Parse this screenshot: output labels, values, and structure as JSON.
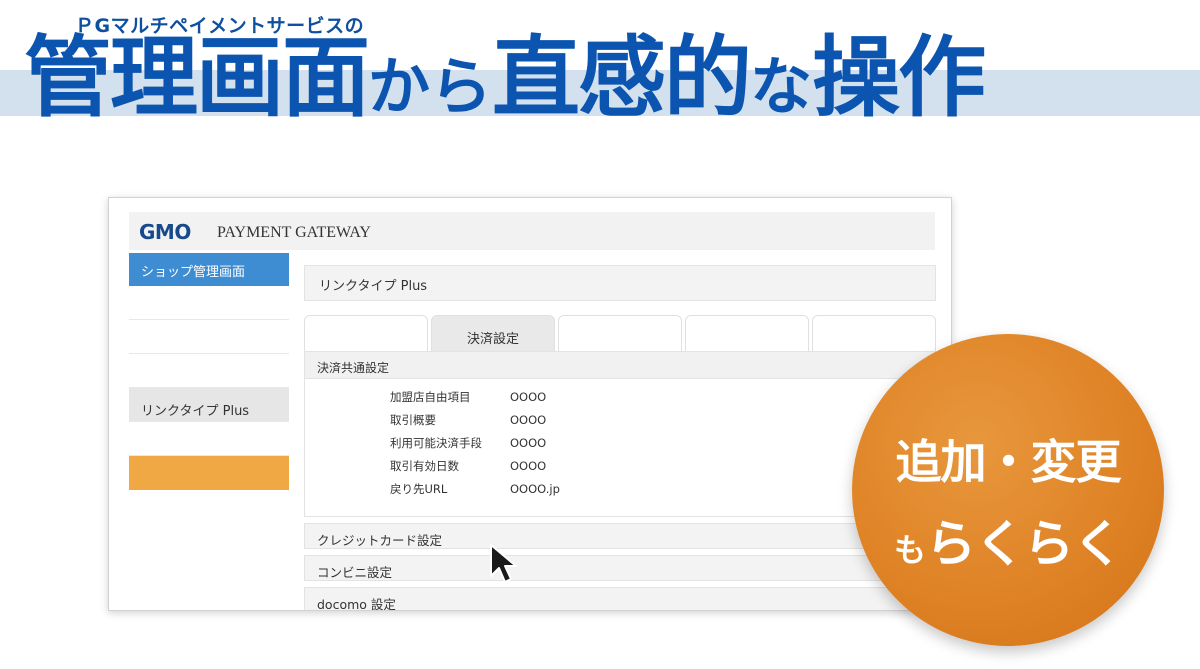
{
  "header": {
    "subtitle": "ＰGマルチペイメントサービスの",
    "headline_part1": "管理画面",
    "headline_part2": "から",
    "headline_part3": "直感的",
    "headline_part4": "な",
    "headline_part5": "操作"
  },
  "app": {
    "logo_mark": "GMO",
    "logo_text": "PAYMENT GATEWAY",
    "sidebar": {
      "items": [
        {
          "label": "ショップ管理画面"
        },
        {
          "label": ""
        },
        {
          "label": ""
        },
        {
          "label": ""
        },
        {
          "label": "リンクタイプ Plus"
        },
        {
          "label": ""
        },
        {
          "label": ""
        }
      ]
    },
    "page_title": "リンクタイプ Plus",
    "tabs": [
      {
        "label": ""
      },
      {
        "label": "決済設定"
      },
      {
        "label": ""
      },
      {
        "label": ""
      },
      {
        "label": ""
      }
    ],
    "panel_title": "決済共通設定",
    "fields": [
      {
        "key": "加盟店自由項目",
        "value": "OOOO"
      },
      {
        "key": "取引概要",
        "value": "OOOO"
      },
      {
        "key": "利用可能決済手段",
        "value": "OOOO"
      },
      {
        "key": "取引有効日数",
        "value": "OOOO"
      },
      {
        "key": "戻り先URL",
        "value": "OOOO.jp"
      }
    ],
    "sections": [
      {
        "label": "クレジットカード設定"
      },
      {
        "label": "コンビニ設定"
      },
      {
        "label": "docomo 設定"
      }
    ]
  },
  "badge": {
    "line1": "追加・変更",
    "line2_small": "も",
    "line2_big": "らくらく"
  },
  "colors": {
    "headline_blue": "#0b55b0",
    "band": "#d3e1ee",
    "sidebar_active": "#3e8dd2",
    "sidebar_orange": "#f0a845",
    "badge_orange": "#df8326"
  }
}
